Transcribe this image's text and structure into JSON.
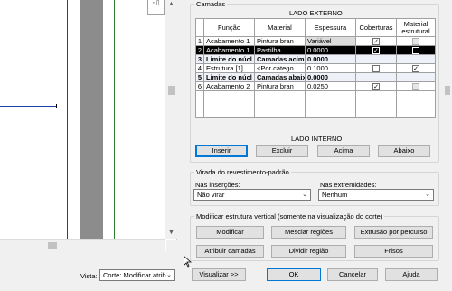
{
  "preview": {
    "zoom_symbol": "◦ ▯"
  },
  "layers": {
    "group_title": "Camadas",
    "top_side": "LADO EXTERNO",
    "bottom_side": "LADO INTERNO",
    "columns": [
      "Função",
      "Material",
      "Espessura",
      "Coberturas",
      "Material estrutural"
    ],
    "rows": [
      {
        "num": "1",
        "funcao": "Acabamento 1",
        "material": "Pintura bran",
        "espessura": "Variável",
        "cobertura": "checked",
        "estrutural": "disabled"
      },
      {
        "num": "2",
        "funcao": "Acabamento 1",
        "material": "Pastilha",
        "espessura": "0.0000",
        "cobertura": "checked",
        "estrutural": "disabled"
      },
      {
        "num": "3",
        "funcao": "Limite do núcl",
        "material": "Camadas acim",
        "espessura": "0.0000",
        "cobertura": "",
        "estrutural": ""
      },
      {
        "num": "4",
        "funcao": "Estrutura [1]",
        "material": "<Por catego",
        "espessura": "0.1000",
        "cobertura": "unchecked",
        "estrutural": "checked"
      },
      {
        "num": "5",
        "funcao": "Limite do núcl",
        "material": "Camadas abaix",
        "espessura": "0.0000",
        "cobertura": "",
        "estrutural": ""
      },
      {
        "num": "6",
        "funcao": "Acabamento 2",
        "material": "Pintura bran",
        "espessura": "0.0250",
        "cobertura": "checked",
        "estrutural": "disabled"
      }
    ],
    "buttons": {
      "insert": "Inserir",
      "delete": "Excluir",
      "up": "Acima",
      "down": "Abaixo"
    }
  },
  "wrap": {
    "group_title": "Virada do revestimento-padrão",
    "inserts_label": "Nas inserções:",
    "inserts_value": "Não virar",
    "ends_label": "Nas extremidades:",
    "ends_value": "Nenhum"
  },
  "vertical": {
    "group_title": "Modificar estrutura vertical (somente na visualização do corte)",
    "buttons": {
      "modify": "Modificar",
      "merge": "Mesclar regiões",
      "sweeps": "Extrusão por percurso",
      "assign": "Atribuir camadas",
      "split": "Dividir região",
      "reveals": "Frisos"
    }
  },
  "footer": {
    "view_label": "Vista:",
    "view_value": "Corte: Modificar atrib",
    "preview_button": "Visualizar >>",
    "ok": "OK",
    "cancel": "Cancelar",
    "help": "Ajuda"
  },
  "colors": {
    "selection": "#000000",
    "accent": "#0078d7"
  }
}
